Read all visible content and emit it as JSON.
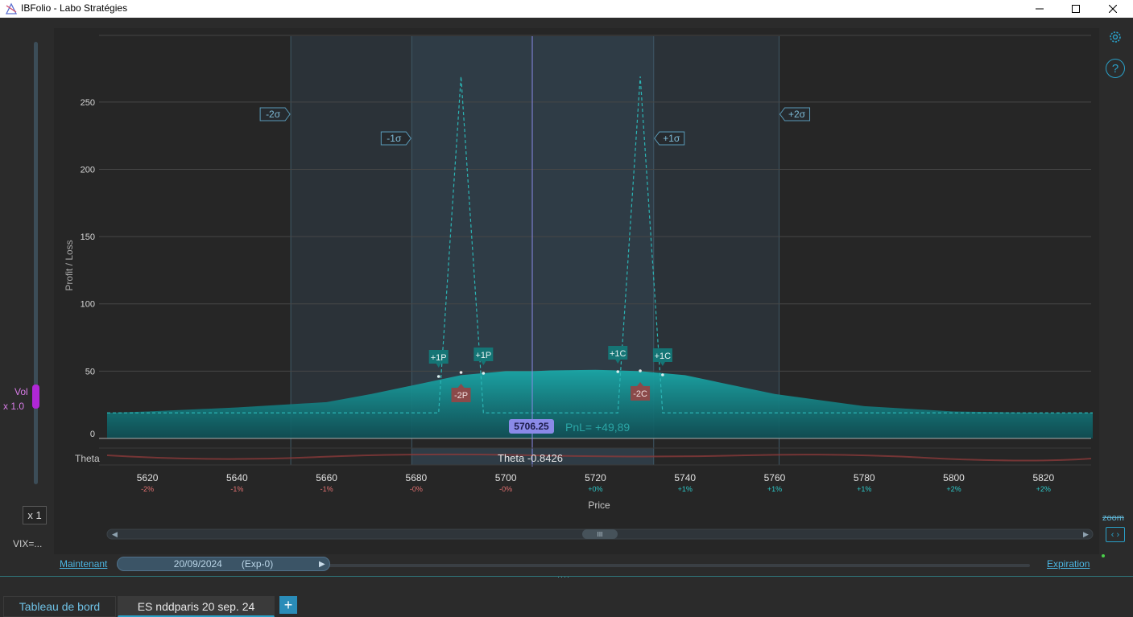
{
  "window": {
    "title": "IBFolio - Labo Stratégies"
  },
  "left_panel": {
    "vol_label": "Vol",
    "vol_multiplier": "x 1.0",
    "x1_button": "x 1",
    "vix_label": "VIX=..."
  },
  "right_panel": {
    "help_label": "?",
    "zoom_label": "zoom"
  },
  "chart": {
    "y_axis_label": "Profit / Loss",
    "x_axis_label": "Price",
    "theta_row_label": "Theta",
    "cursor_price": "5706.25",
    "pnl_readout": "PnL= +49,89",
    "theta_readout": "Theta -0.8426",
    "sigma_labels": {
      "minus2": "-2σ",
      "minus1": "-1σ",
      "plus1": "+1σ",
      "plus2": "+2σ"
    },
    "y_ticks": [
      "250",
      "200",
      "150",
      "100",
      "50",
      "0"
    ],
    "x_ticks": [
      {
        "price": "5620",
        "pct": "-2%"
      },
      {
        "price": "5640",
        "pct": "-1%"
      },
      {
        "price": "5660",
        "pct": "-1%"
      },
      {
        "price": "5680",
        "pct": "-0%"
      },
      {
        "price": "5700",
        "pct": "-0%"
      },
      {
        "price": "5720",
        "pct": "+0%"
      },
      {
        "price": "5740",
        "pct": "+1%"
      },
      {
        "price": "5760",
        "pct": "+1%"
      },
      {
        "price": "5780",
        "pct": "+1%"
      },
      {
        "price": "5800",
        "pct": "+2%"
      },
      {
        "price": "5820",
        "pct": "+2%"
      }
    ],
    "legs": {
      "long_put_1": "+1P",
      "long_put_2": "+1P",
      "long_call_1": "+1C",
      "long_call_2": "+1C",
      "short_put": "-2P",
      "short_call": "-2C"
    },
    "scrollbar_thumb": "III",
    "colors": {
      "accent": "#1f9a9a",
      "short_leg": "#8b4a4a",
      "cursor": "#8a8ae8",
      "sigma": "#5a9ab8"
    }
  },
  "chart_data": {
    "type": "area",
    "xlabel": "Price",
    "ylabel": "Profit / Loss",
    "xlim": [
      5611,
      5831
    ],
    "ylim": [
      0,
      275
    ],
    "grid": true,
    "series": [
      {
        "x": [
          5611,
          5620,
          5640,
          5660,
          5670,
          5680,
          5690,
          5700,
          5706.25,
          5710,
          5720,
          5730,
          5740,
          5750,
          5760,
          5780,
          5800,
          5820,
          5831
        ],
        "y": [
          19,
          20,
          23,
          27,
          33,
          40,
          47,
          50,
          50,
          50.5,
          51,
          50,
          47,
          40,
          33,
          24,
          20,
          19,
          19
        ]
      },
      {
        "x": [
          5611,
          5685,
          5690,
          5695,
          5725,
          5730,
          5735,
          5831
        ],
        "y": [
          19,
          19,
          269,
          19,
          19,
          269,
          19,
          19
        ]
      }
    ]
  },
  "timeline": {
    "now_link": "Maintenant",
    "date": "20/09/2024",
    "exp": "(Exp-0)",
    "expiration_link": "Expiration"
  },
  "tabs": {
    "dashboard": "Tableau de bord",
    "strategy": "ES nddparis 20 sep. 24",
    "add": "+"
  }
}
